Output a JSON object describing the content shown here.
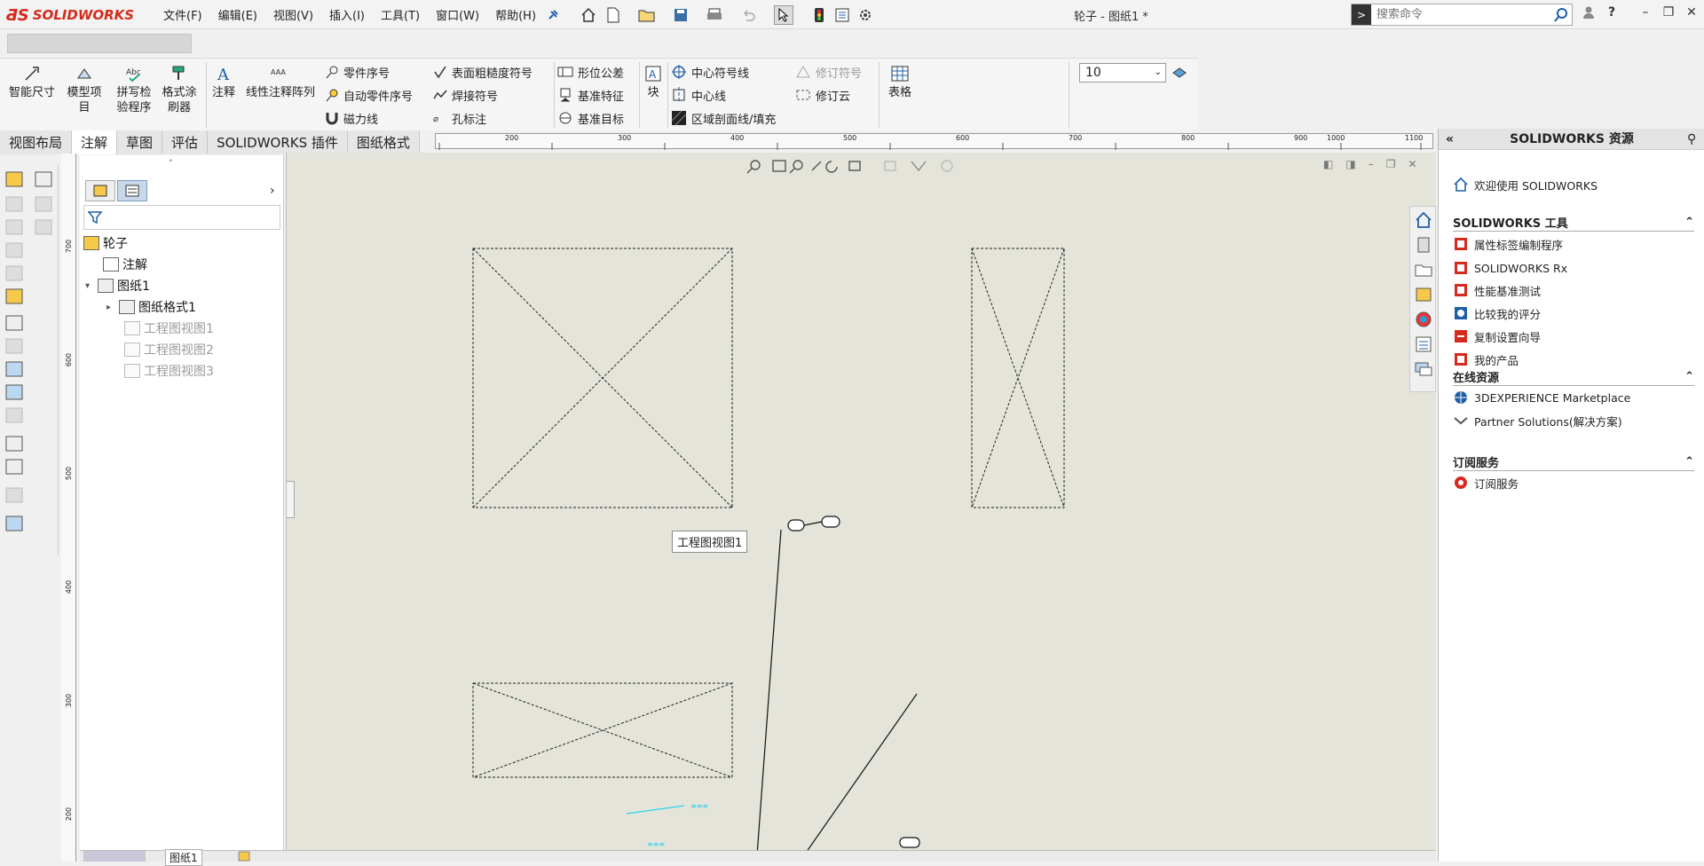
{
  "app": {
    "logo_text": "SOLIDWORKS",
    "document_title": "轮子 - 图纸1 *"
  },
  "menu": [
    "文件(F)",
    "编辑(E)",
    "视图(V)",
    "插入(I)",
    "工具(T)",
    "窗口(W)",
    "帮助(H)"
  ],
  "search": {
    "placeholder": "搜索命令"
  },
  "toolbar": {
    "smart_dimension": "智能尺寸",
    "model_items": "模型项目",
    "spell_checker": "拼写检验程序",
    "format_painter": "格式涂刷器",
    "note": "注释",
    "linear_note_pattern": "线性注释阵列",
    "balloon": "零件序号",
    "auto_balloon": "自动零件序号",
    "magnetic_line": "磁力线",
    "surface_finish": "表面粗糙度符号",
    "weld_symbol": "焊接符号",
    "hole_callout": "孔标注",
    "geometric_tolerance": "形位公差",
    "datum_feature": "基准特征",
    "datum_target": "基准目标",
    "block": "块",
    "center_mark": "中心符号线",
    "centerline": "中心线",
    "area_hatch": "区域剖面线/填充",
    "revision_symbol": "修订符号",
    "revision_cloud": "修订云",
    "table": "表格",
    "font_size_value": "10"
  },
  "tabs": [
    "视图布局",
    "注解",
    "草图",
    "评估",
    "SOLIDWORKS 插件",
    "图纸格式"
  ],
  "active_tab_index": 1,
  "ruler": {
    "h_ticks": [
      "200",
      "300",
      "400",
      "500",
      "600",
      "700",
      "800",
      "900",
      "1000",
      "1100"
    ],
    "v_ticks": [
      "700",
      "600",
      "500",
      "400",
      "300",
      "200"
    ]
  },
  "tree": {
    "root": "轮子",
    "annotations": "注解",
    "sheet": "图纸1",
    "sheet_format": "图纸格式1",
    "views": [
      "工程图视图1",
      "工程图视图2",
      "工程图视图3"
    ]
  },
  "canvas": {
    "view_label": "工程图视图1"
  },
  "status": {
    "sheet_tab": "图纸1"
  },
  "resources": {
    "header": "SOLIDWORKS 资源",
    "welcome": "欢迎使用  SOLIDWORKS",
    "tools_title": "SOLIDWORKS 工具",
    "tools": [
      "属性标签编制程序",
      "SOLIDWORKS Rx",
      "性能基准测试",
      "比较我的评分",
      "复制设置向导",
      "我的产品"
    ],
    "online_title": "在线资源",
    "online": [
      "3DEXPERIENCE Marketplace",
      "Partner Solutions(解决方案)"
    ],
    "subscription_title": "订阅服务",
    "subscription": [
      "订阅服务"
    ]
  },
  "colors": {
    "brand": "#d52b1e",
    "canvas_bg": "#e4e4da",
    "accent_blue": "#1f5fa8"
  }
}
